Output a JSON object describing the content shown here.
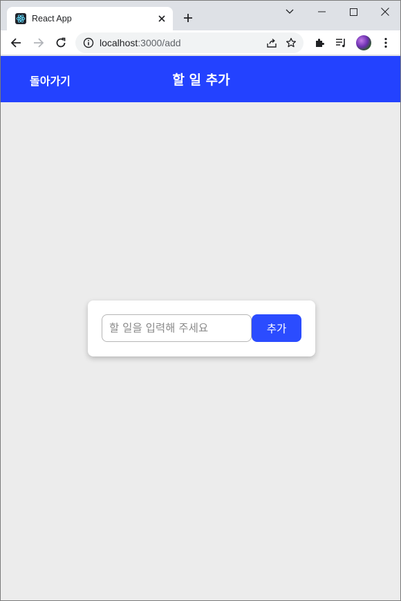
{
  "browser": {
    "tab_title": "React App",
    "url_host": "localhost",
    "url_path": ":3000/add",
    "accent_color": "#2342ff"
  },
  "icons": [
    "react-icon",
    "close-icon",
    "plus-icon",
    "minimize-icon",
    "maximize-icon",
    "chevron-down-icon",
    "back-arrow-icon",
    "forward-arrow-icon",
    "reload-icon",
    "info-icon",
    "share-icon",
    "star-icon",
    "extensions-icon",
    "reading-list-icon",
    "kebab-menu-icon"
  ],
  "header": {
    "back_label": "돌아가기",
    "title": "할 일 추가"
  },
  "form": {
    "input_value": "",
    "input_placeholder": "할 일을 입력해 주세요",
    "submit_label": "추가"
  }
}
